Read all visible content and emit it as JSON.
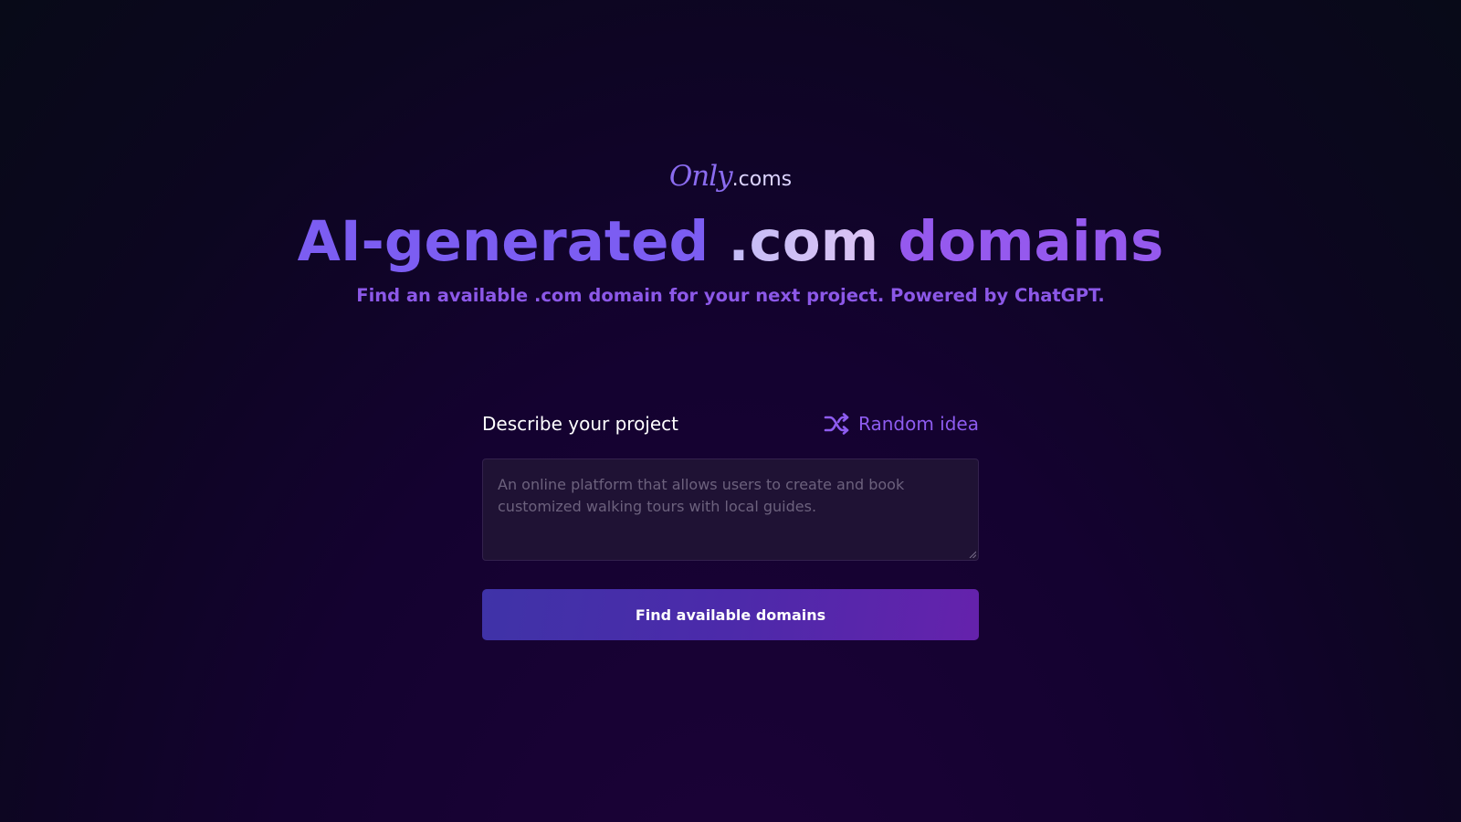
{
  "brand": {
    "only": "Only",
    "coms": ".coms"
  },
  "hero": {
    "headline_part1": "AI-generated ",
    "headline_part2": ".com",
    "headline_part3": " domains",
    "subtitle": "Find an available .com domain for your next project. Powered by ChatGPT."
  },
  "form": {
    "label": "Describe your project",
    "random_label": "Random idea",
    "random_icon": "shuffle-icon",
    "textarea_value": "",
    "textarea_placeholder": "An online platform that allows users to create and book customized walking tours with local guides.",
    "submit_label": "Find available domains"
  },
  "colors": {
    "accent": "#7c5df2",
    "accent_secondary": "#9559ee",
    "button_start": "#3f33a8",
    "button_end": "#6522ac"
  }
}
